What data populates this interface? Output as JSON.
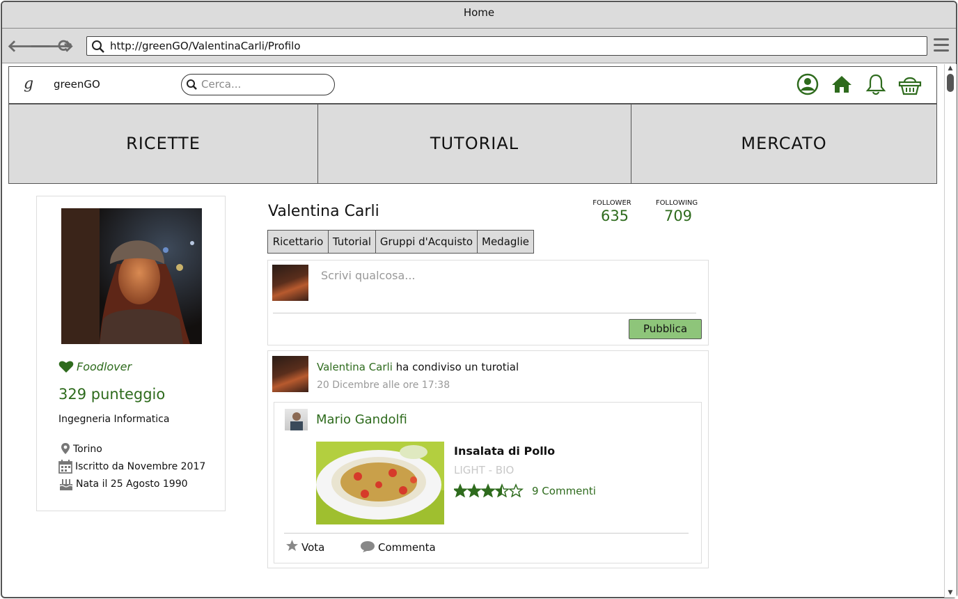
{
  "browser": {
    "title": "Home",
    "url": "http://greenGO/ValentinaCarli/Profilo"
  },
  "site": {
    "logo_letter": "g",
    "brand": "greenGO",
    "search_placeholder": "Cerca...",
    "header_icons": [
      "user-circle-icon",
      "home-icon",
      "bell-icon",
      "basket-icon"
    ],
    "categories": [
      "RICETTE",
      "TUTORIAL",
      "MERCATO"
    ],
    "accent_color": "#2e6b1d"
  },
  "profile": {
    "badge": "Foodlover",
    "score": "329 punteggio",
    "study": "Ingegneria Informatica",
    "city": "Torino",
    "joined": "Iscritto da Novembre 2017",
    "birth": "Nata il 25 Agosto 1990",
    "name": "Valentina Carli",
    "follower_label": "FOLLOWER",
    "follower_count": "635",
    "following_label": "FOLLOWING",
    "following_count": "709"
  },
  "tabs": [
    "Ricettario",
    "Tutorial",
    "Gruppi d'Acquisto",
    "Medaglie"
  ],
  "composer": {
    "placeholder": "Scrivi qualcosa...",
    "publish_label": "Pubblica"
  },
  "post": {
    "author": "Valentina Carli",
    "action": "ha condiviso un turotial",
    "timestamp": "20 Dicembre alle ore 17:38",
    "shared": {
      "author": "Mario Gandolfi",
      "recipe_title": "Insalata di Pollo",
      "recipe_tags": "LIGHT - BIO",
      "rating": 3.5,
      "rating_max": 5,
      "comments": "9 Commenti"
    },
    "vote_label": "Vota",
    "comment_label": "Commenta"
  }
}
